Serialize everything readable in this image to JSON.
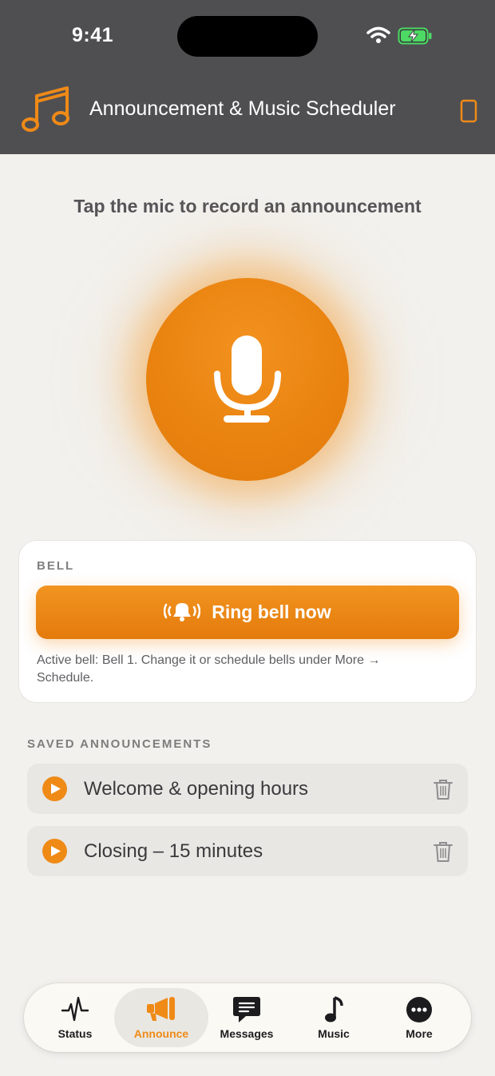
{
  "status_bar": {
    "time": "9:41"
  },
  "header": {
    "title": "Announcement & Music Scheduler",
    "logo_icon": "music-notes-icon",
    "device_icon": "phone-icon"
  },
  "main": {
    "prompt": "Tap the mic to record an announcement",
    "mic_icon": "microphone-icon"
  },
  "bell_card": {
    "label": "BELL",
    "button_label": "Ring bell now",
    "note": "Active bell: Bell 1. Change it or schedule bells under More → Schedule."
  },
  "saved": {
    "header": "SAVED ANNOUNCEMENTS",
    "items": [
      {
        "label": "Welcome & opening hours"
      },
      {
        "label": "Closing – 15 minutes"
      }
    ]
  },
  "tabs": [
    {
      "label": "Status",
      "icon": "waveform-icon"
    },
    {
      "label": "Announce",
      "icon": "megaphone-icon"
    },
    {
      "label": "Messages",
      "icon": "message-icon"
    },
    {
      "label": "Music",
      "icon": "music-note-icon"
    },
    {
      "label": "More",
      "icon": "more-icon"
    }
  ],
  "colors": {
    "accent": "#ef8a17",
    "header_bg": "#4f4f52",
    "page_bg": "#f2f1ee"
  },
  "active_tab": "Announce"
}
